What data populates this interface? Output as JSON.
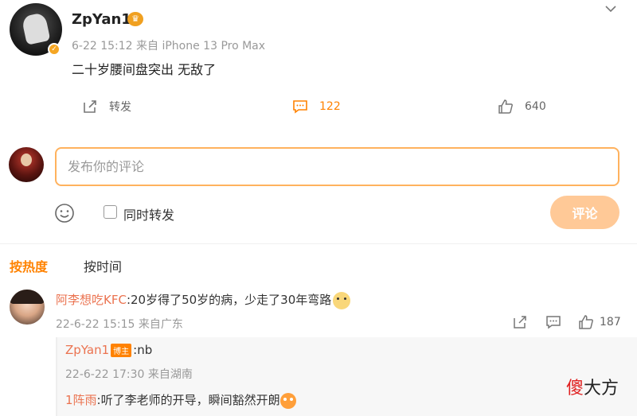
{
  "post": {
    "author": "ZpYan1",
    "meta": "6-22 15:12 来自 iPhone 13 Pro Max",
    "text": "二十岁腰间盘突出 无敌了"
  },
  "actions": {
    "forward_label": "转发",
    "comment_count": "122",
    "like_count": "640"
  },
  "composer": {
    "placeholder": "发布你的评论",
    "repost_label": "同时转发",
    "submit_label": "评论"
  },
  "sort_tabs": {
    "hot": "按热度",
    "time": "按时间"
  },
  "comment": {
    "user": "阿李想吃KFC",
    "text": ":20岁得了50岁的病，少走了30年弯路",
    "meta": "22-6-22 15:15 来自广东",
    "like_count": "187"
  },
  "replies": [
    {
      "user": "ZpYan1",
      "badge": "博主",
      "text": ":nb",
      "meta": "22-6-22 17:30 来自湖南"
    },
    {
      "user": "1阵雨",
      "text": ":听了李老师的开导，瞬间豁然开朗"
    }
  ],
  "watermark": {
    "red": "傻",
    "black": "大方"
  },
  "colors": {
    "accent": "#ff8200",
    "username": "#eb7350",
    "submit_disabled": "#ffc997"
  }
}
